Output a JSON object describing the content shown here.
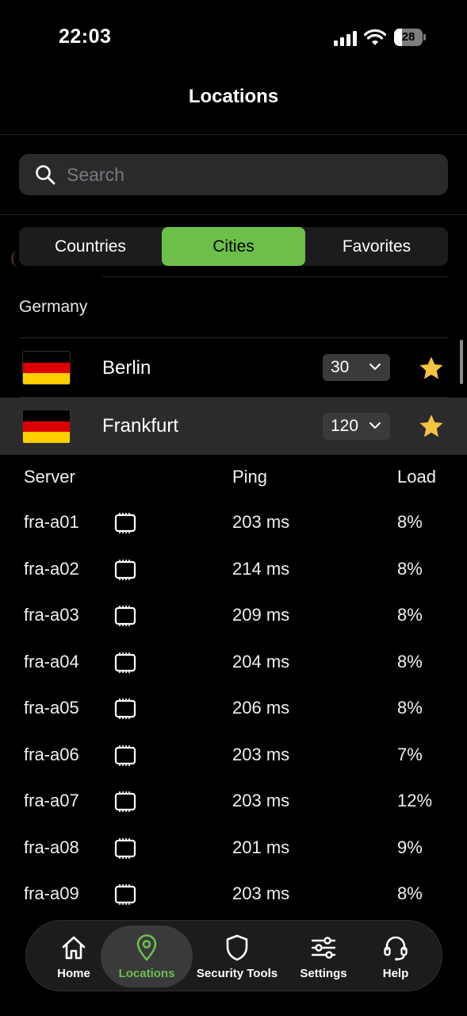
{
  "status_bar": {
    "time": "22:03",
    "battery": "28",
    "battery_level": 0.28
  },
  "header": {
    "title": "Locations"
  },
  "search": {
    "placeholder": "Search"
  },
  "segments": [
    {
      "label": "Countries",
      "active": false
    },
    {
      "label": "Cities",
      "active": true
    },
    {
      "label": "Favorites",
      "active": false
    }
  ],
  "section": {
    "country": "Germany"
  },
  "cities": [
    {
      "name": "Berlin",
      "count": "30",
      "favorite": true,
      "selected": false
    },
    {
      "name": "Frankfurt",
      "count": "120",
      "favorite": true,
      "selected": true
    }
  ],
  "servers": {
    "headers": {
      "server": "Server",
      "ping": "Ping",
      "load": "Load"
    },
    "rows": [
      {
        "name": "fra-a01",
        "ping": "203 ms",
        "load": "8%"
      },
      {
        "name": "fra-a02",
        "ping": "214 ms",
        "load": "8%"
      },
      {
        "name": "fra-a03",
        "ping": "209 ms",
        "load": "8%"
      },
      {
        "name": "fra-a04",
        "ping": "204 ms",
        "load": "8%"
      },
      {
        "name": "fra-a05",
        "ping": "206 ms",
        "load": "8%"
      },
      {
        "name": "fra-a06",
        "ping": "203 ms",
        "load": "7%"
      },
      {
        "name": "fra-a07",
        "ping": "203 ms",
        "load": "12%"
      },
      {
        "name": "fra-a08",
        "ping": "201 ms",
        "load": "9%"
      },
      {
        "name": "fra-a09",
        "ping": "203 ms",
        "load": "8%"
      }
    ]
  },
  "tabbar": [
    {
      "label": "Home",
      "icon": "home-icon",
      "active": false
    },
    {
      "label": "Locations",
      "icon": "location-pin-icon",
      "active": true
    },
    {
      "label": "Security Tools",
      "icon": "shield-icon",
      "active": false
    },
    {
      "label": "Settings",
      "icon": "sliders-icon",
      "active": false
    },
    {
      "label": "Help",
      "icon": "headset-icon",
      "active": false
    }
  ],
  "colors": {
    "accent": "#6cc04a",
    "star": "#f5c242",
    "background": "#000000"
  }
}
